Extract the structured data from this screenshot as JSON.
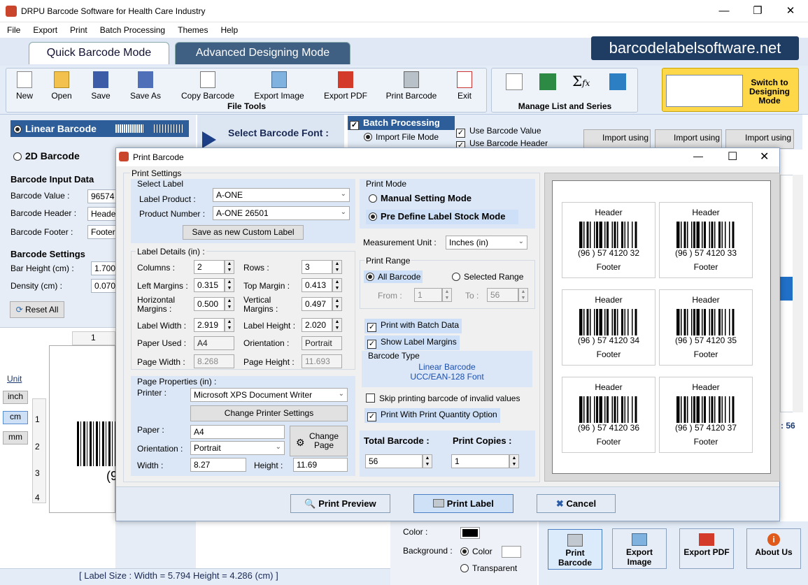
{
  "app": {
    "title": "DRPU Barcode Software for Health Care Industry",
    "brand": "barcodelabelsoftware.net"
  },
  "menu": [
    "File",
    "Export",
    "Print",
    "Batch Processing",
    "Themes",
    "Help"
  ],
  "tabs": {
    "quick": "Quick Barcode Mode",
    "advanced": "Advanced Designing Mode"
  },
  "toolbar": {
    "new": "New",
    "open": "Open",
    "save": "Save",
    "save_as": "Save As",
    "copy": "Copy Barcode",
    "export_image": "Export Image",
    "export_pdf": "Export PDF",
    "print": "Print Barcode",
    "exit": "Exit",
    "group_file": "File Tools",
    "group_list": "Manage List and Series",
    "switch": "Switch to Designing Mode"
  },
  "left": {
    "linear": "Linear Barcode",
    "twod": "2D Barcode",
    "input_hdr": "Barcode Input Data",
    "value_lbl": "Barcode Value :",
    "value": "96574",
    "header_lbl": "Barcode Header :",
    "header": "Header",
    "footer_lbl": "Barcode Footer :",
    "footer": "Footer",
    "settings_hdr": "Barcode Settings",
    "bar_height_lbl": "Bar Height (cm) :",
    "bar_height": "1.700",
    "density_lbl": "Density (cm) :",
    "density": "0.070",
    "reset": "Reset All",
    "unit": "Unit",
    "inch": "inch",
    "cm": "cm",
    "mm": "mm",
    "ruler_top": "1",
    "ruler_left": [
      "1",
      "2",
      "3",
      "4"
    ],
    "barcode_partial": "(9"
  },
  "mid": {
    "select_font": "Select Barcode Font :",
    "batch": "Batch Processing",
    "import_file": "Import File Mode",
    "use_value": "Use Barcode Value",
    "use_header": "Use Barcode Header",
    "import1": "Import using",
    "import2": "Import using",
    "import3": "Import using"
  },
  "status": {
    "label_size": "[ Label Size : Width = 5.794  Height = 4.286 (cm) ]",
    "count": ": 56"
  },
  "bottomright": {
    "color": "Color :",
    "background": "Background :",
    "bg_color": "Color",
    "transparent": "Transparent",
    "print": "Print Barcode",
    "export_img": "Export Image",
    "export_pdf": "Export PDF",
    "about": "About Us"
  },
  "dialog": {
    "title": "Print Barcode",
    "print_settings": "Print Settings",
    "select_label": "Select Label",
    "label_product_lbl": "Label Product :",
    "label_product": "A-ONE",
    "product_number_lbl": "Product Number :",
    "product_number": "A-ONE 26501",
    "save_custom": "Save as new Custom Label",
    "label_details": "Label Details (in) :",
    "columns_lbl": "Columns :",
    "columns": "2",
    "rows_lbl": "Rows :",
    "rows": "3",
    "left_margins_lbl": "Left Margins :",
    "left_margins": "0.315",
    "top_margin_lbl": "Top Margin :",
    "top_margin": "0.413",
    "horiz_lbl": "Horizontal Margins :",
    "horiz": "0.500",
    "vert_lbl": "Vertical Margins :",
    "vert": "0.497",
    "label_width_lbl": "Label Width :",
    "label_width": "2.919",
    "label_height_lbl": "Label Height :",
    "label_height": "2.020",
    "paper_used_lbl": "Paper Used :",
    "paper_used": "A4",
    "orientation_lbl": "Orientation :",
    "orientation": "Portrait",
    "page_width_lbl": "Page Width :",
    "page_width": "8.268",
    "page_height_lbl": "Page Height :",
    "page_height": "11.693",
    "page_props": "Page Properties (in) :",
    "printer_lbl": "Printer :",
    "printer": "Microsoft XPS Document Writer",
    "change_printer": "Change Printer Settings",
    "paper_lbl": "Paper :",
    "paper": "A4",
    "orient2_lbl": "Orientation :",
    "orient2": "Portrait",
    "change_page": "Change Page",
    "width_lbl": "Width :",
    "width": "8.27",
    "height_lbl": "Height :",
    "height": "11.69",
    "print_mode": "Print Mode",
    "manual": "Manual Setting Mode",
    "predefine": "Pre Define Label Stock Mode",
    "unit_lbl": "Measurement Unit :",
    "unit": "Inches (in)",
    "print_range": "Print Range",
    "all_barcode": "All Barcode",
    "selected_range": "Selected Range",
    "from_lbl": "From :",
    "from": "1",
    "to_lbl": "To :",
    "to": "56",
    "batch_data": "Print with Batch Data",
    "show_margins": "Show Label Margins",
    "barcode_type": "Barcode Type",
    "type_line1": "Linear Barcode",
    "type_line2": "UCC/EAN-128 Font",
    "skip_invalid": "Skip printing barcode of invalid values",
    "qty_option": "Print With Print Quantity Option",
    "total_lbl": "Total Barcode :",
    "total": "56",
    "copies_lbl": "Print Copies :",
    "copies": "1",
    "preview_btn": "Print Preview",
    "print_btn": "Print Label",
    "cancel_btn": "Cancel",
    "labels": [
      {
        "header": "Header",
        "value": "(96 ) 57 4120 32",
        "footer": "Footer"
      },
      {
        "header": "Header",
        "value": "(96 ) 57 4120 33",
        "footer": "Footer"
      },
      {
        "header": "Header",
        "value": "(96 ) 57 4120 34",
        "footer": "Footer"
      },
      {
        "header": "Header",
        "value": "(96 ) 57 4120 35",
        "footer": "Footer"
      },
      {
        "header": "Header",
        "value": "(96 ) 57 4120 36",
        "footer": "Footer"
      },
      {
        "header": "Header",
        "value": "(96 ) 57 4120 37",
        "footer": "Footer"
      }
    ]
  }
}
